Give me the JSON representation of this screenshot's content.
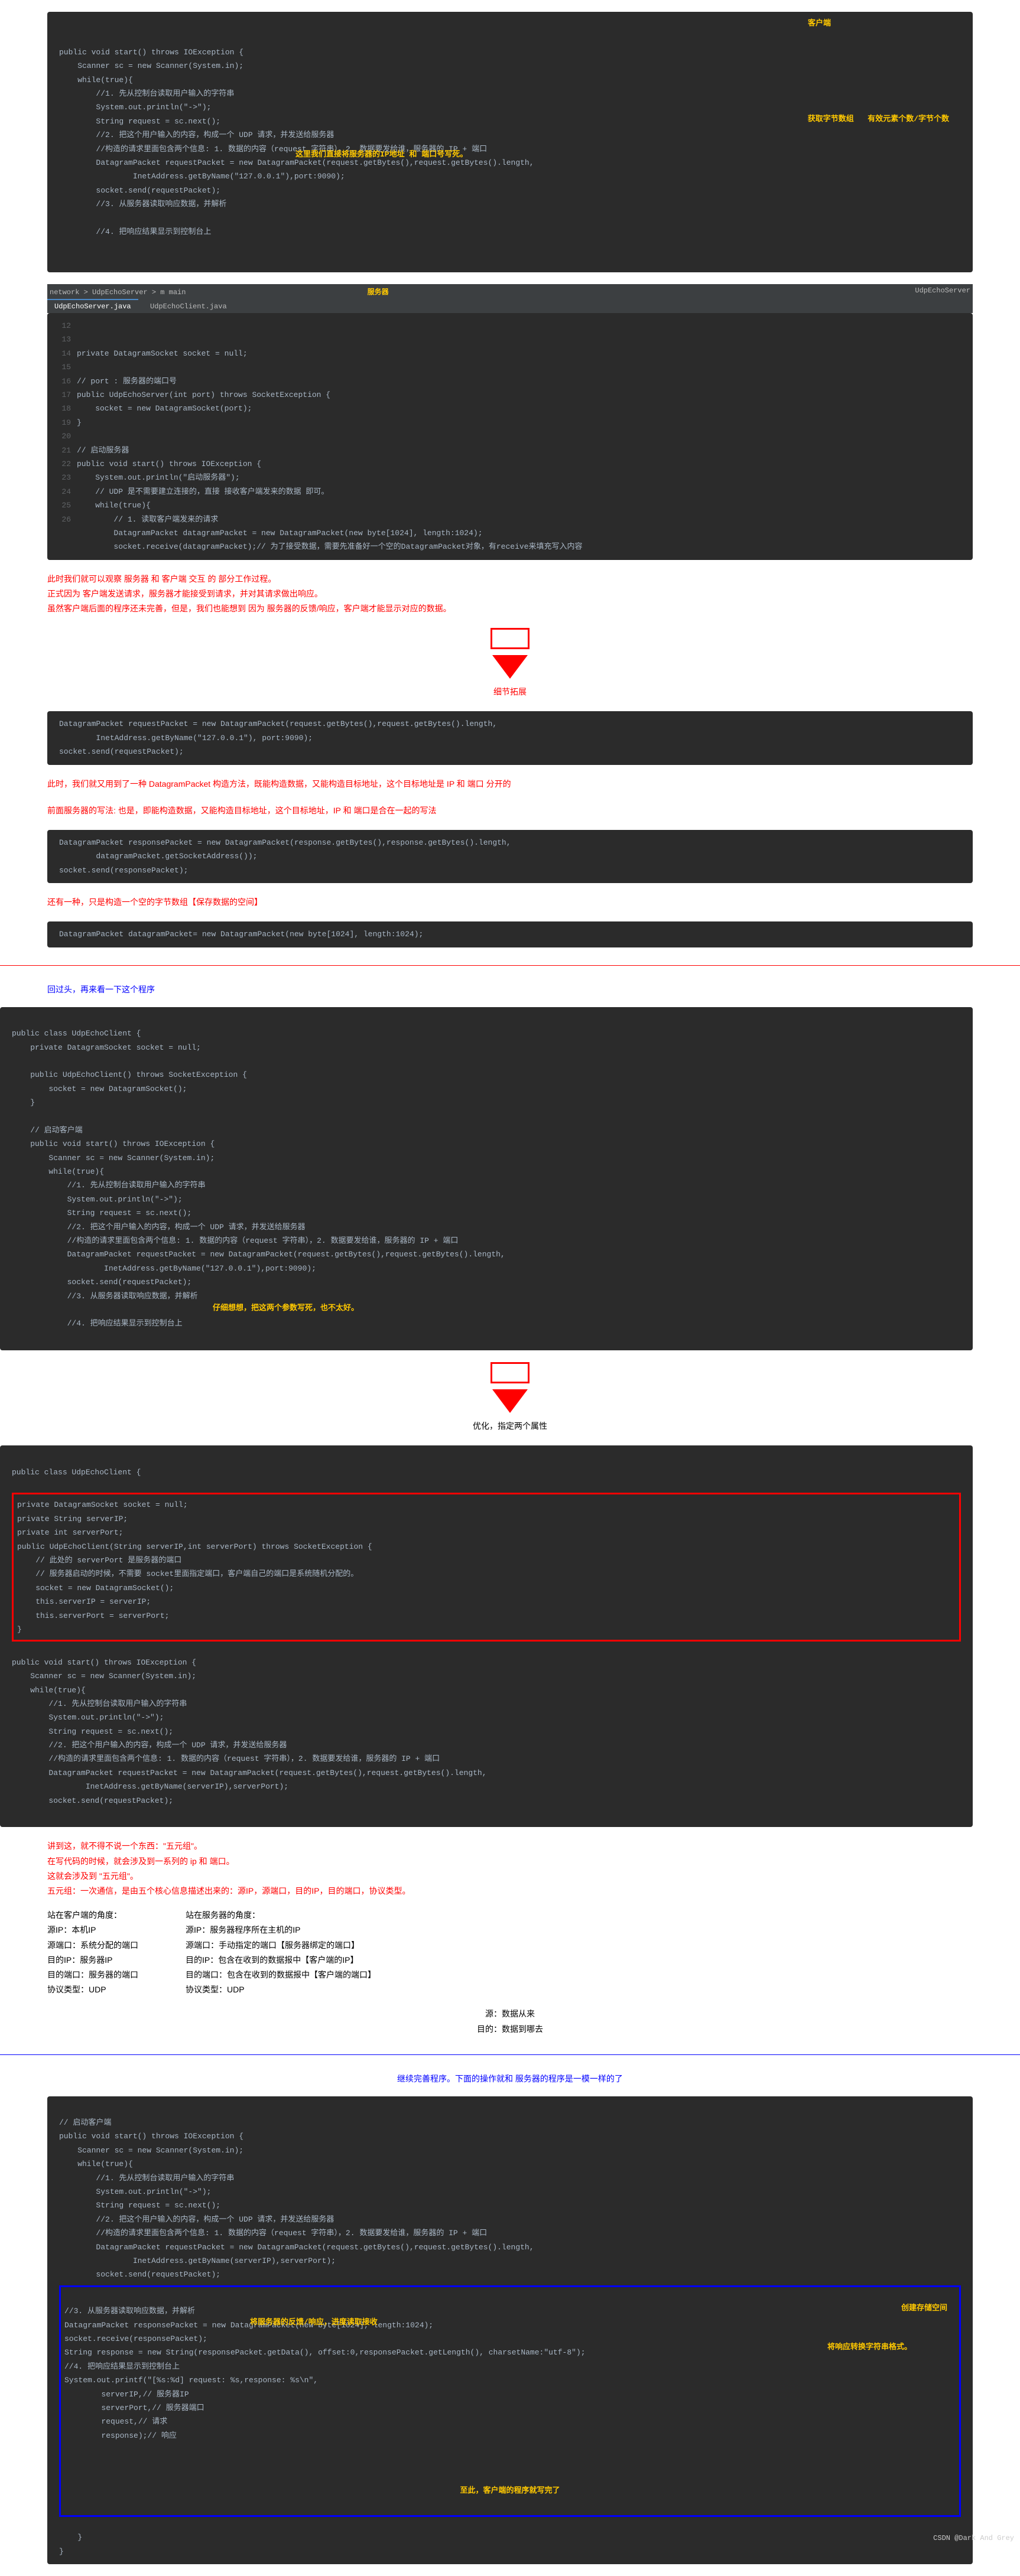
{
  "block1": {
    "title": "客户端",
    "lines": "public void start() throws IOException {\n    Scanner sc = new Scanner(System.in);\n    while(true){\n        //1. 先从控制台读取用户输入的字符串\n        System.out.println(\"->\");\n        String request = sc.next();\n        //2. 把这个用户输入的内容，构成一个 UDP 请求，并发送给服务器\n        //构造的请求里面包含两个信息: 1. 数据的内容（request 字符串），2. 数据要发给谁，服务器的 IP + 端口\n        DatagramPacket requestPacket = new DatagramPacket(request.getBytes(),request.getBytes().length,\n                InetAddress.getByName(\"127.0.0.1\"),port:9090);\n        socket.send(requestPacket);\n        //3. 从服务器读取响应数据，并解析\n\n        //4. 把响应结果显示到控制台上",
    "anno1": "获取字节数组",
    "anno2": "有效元素个数/字节个数",
    "anno3": "这里我们直接将服务器的IP地址 和 端口号写死。"
  },
  "block2": {
    "title": "服务器",
    "tabs": [
      "UdpEchoServer.java",
      "UdpEchoClient.java"
    ],
    "breadcrumb": "network > UdpEchoServer > m main",
    "topRight": "UdpEchoServer",
    "lines": "private DatagramSocket socket = null;\n\n// port : 服务器的端口号\npublic UdpEchoServer(int port) throws SocketException {\n    socket = new DatagramSocket(port);\n}\n\n// 启动服务器\npublic void start() throws IOException {\n    System.out.println(\"启动服务器\");\n    // UDP 是不需要建立连接的，直接 接收客户端发来的数据 即可。\n    while(true){\n        // 1. 读取客户端发来的请求\n        DatagramPacket datagramPacket = new DatagramPacket(new byte[1024], length:1024);\n        socket.receive(datagramPacket);// 为了接受数据，需要先准备好一个空的DatagramPacket对象，有receive来填充写入内容"
  },
  "red1": "此时我们就可以观察 服务器 和 客户端 交互 的 部分工作过程。\n正式因为 客户端发送请求，服务器才能接受到请求，并对其请求做出响应。\n虽然客户端后面的程序还未完善，但是，我们也能想到 因为 服务器的反馈/响应，客户端才能显示对应的数据。",
  "detail": "细节拓展",
  "block3": {
    "lines": "DatagramPacket requestPacket = new DatagramPacket(request.getBytes(),request.getBytes().length,\n        InetAddress.getByName(\"127.0.0.1\"), port:9090);\nsocket.send(requestPacket);"
  },
  "red2": "此时，我们就又用到了一种 DatagramPacket 构造方法，既能构造数据，又能构造目标地址，这个目标地址是 IP 和 端口 分开的",
  "red3": "前面服务器的写法: 也是，即能构造数据，又能构造目标地址，这个目标地址，IP 和 端口是合在一起的写法",
  "block4": {
    "lines": "DatagramPacket responsePacket = new DatagramPacket(response.getBytes(),response.getBytes().length,\n        datagramPacket.getSocketAddress());\nsocket.send(responsePacket);"
  },
  "red4": "还有一种，只是构造一个空的字节数组【保存数据的空间】",
  "block5": {
    "lines": "DatagramPacket datagramPacket= new DatagramPacket(new byte[1024], length:1024);"
  },
  "blue1": "回过头，再来看一下这个程序",
  "block6": {
    "lines": "public class UdpEchoClient {\n    private DatagramSocket socket = null;\n\n    public UdpEchoClient() throws SocketException {\n        socket = new DatagramSocket();\n    }\n\n    // 启动客户端\n    public void start() throws IOException {\n        Scanner sc = new Scanner(System.in);\n        while(true){\n            //1. 先从控制台读取用户输入的字符串\n            System.out.println(\"->\");\n            String request = sc.next();\n            //2. 把这个用户输入的内容，构成一个 UDP 请求，并发送给服务器\n            //构造的请求里面包含两个信息: 1. 数据的内容（request 字符串），2. 数据要发给谁，服务器的 IP + 端口\n            DatagramPacket requestPacket = new DatagramPacket(request.getBytes(),request.getBytes().length,\n                    InetAddress.getByName(\"127.0.0.1\"),port:9090);\n            socket.send(requestPacket);\n            //3. 从服务器读取响应数据，并解析\n\n            //4. 把响应结果显示到控制台上",
    "anno": "仔细想想，把这两个参数写死，也不太好。"
  },
  "opt": "优化，指定两个属性",
  "block7": {
    "header": "public class UdpEchoClient {",
    "redbox": "private DatagramSocket socket = null;\nprivate String serverIP;\nprivate int serverPort;\npublic UdpEchoClient(String serverIP,int serverPort) throws SocketException {\n    // 此处的 serverPort 是服务器的端口\n    // 服务器启动的时候，不需要 socket里面指定端口，客户端自己的端口是系统随机分配的。\n    socket = new DatagramSocket();\n    this.serverIP = serverIP;\n    this.serverPort = serverPort;\n}",
    "rest": "public void start() throws IOException {\n    Scanner sc = new Scanner(System.in);\n    while(true){\n        //1. 先从控制台读取用户输入的字符串\n        System.out.println(\"->\");\n        String request = sc.next();\n        //2. 把这个用户输入的内容，构成一个 UDP 请求，并发送给服务器\n        //构造的请求里面包含两个信息: 1. 数据的内容（request 字符串），2. 数据要发给谁，服务器的 IP + 端口\n        DatagramPacket requestPacket = new DatagramPacket(request.getBytes(),request.getBytes().length,\n                InetAddress.getByName(serverIP),serverPort);\n        socket.send(requestPacket);"
  },
  "wuyuan": {
    "l1": "讲到这，就不得不说一个东西：\"五元组\"。",
    "l2": "在写代码的时候，就会涉及到一系列的 ip 和 端口。",
    "l3": "这就会涉及到 \"五元组\"。",
    "l4": "五元组：一次通信，是由五个核心信息描述出来的：源IP，源端口，目的IP，目的端口，协议类型。"
  },
  "colL": {
    "h": "站在客户端的角度：",
    "r": [
      "源IP：本机IP",
      "源端口：系统分配的端口",
      "目的IP：服务器IP",
      "目的端口：服务器的端口",
      "协议类型：UDP"
    ]
  },
  "colR": {
    "h": "站在服务器的角度：",
    "r": [
      "源IP：服务器程序所在主机的IP",
      "源端口：手动指定的端口【服务器绑定的端口】",
      "目的IP：包含在收到的数据报中【客户端的IP】",
      "目的端口：包含在收到的数据报中【客户端的端口】",
      "协议类型：UDP"
    ]
  },
  "src": "源：数据从来\n目的：数据到哪去",
  "blue2": "继续完善程序。下面的操作就和 服务器的程序是一模一样的了",
  "block8": {
    "lines": "// 启动客户端\npublic void start() throws IOException {\n    Scanner sc = new Scanner(System.in);\n    while(true){\n        //1. 先从控制台读取用户输入的字符串\n        System.out.println(\"->\");\n        String request = sc.next();\n        //2. 把这个用户输入的内容，构成一个 UDP 请求，并发送给服务器\n        //构造的请求里面包含两个信息: 1. 数据的内容（request 字符串），2. 数据要发给谁，服务器的 IP + 端口\n        DatagramPacket requestPacket = new DatagramPacket(request.getBytes(),request.getBytes().length,\n                InetAddress.getByName(serverIP),serverPort);\n        socket.send(requestPacket);",
    "bluebox": "//3. 从服务器读取响应数据，并解析\nDatagramPacket responsePacket = new DatagramPacket(new byte[1024], length:1024);\nsocket.receive(responsePacket);\nString response = new String(responsePacket.getData(), offset:0,responsePacket.getLength(), charsetName:\"utf-8\");\n//4. 把响应结果显示到控制台上\nSystem.out.printf(\"[%s:%d] request: %s,response: %s\\n\",\n        serverIP,// 服务器IP\n        serverPort,// 服务器端口\n        request,// 请求\n        response);// 响应",
    "anno1": "创建存储空间",
    "anno2": "将服务器的反馈/响应，进度读取接收",
    "anno3": "将响应转换字符串格式。",
    "end": "至此，客户端的程序就写完了",
    "close": "    }\n}"
  },
  "watermark": "CSDN @Dark And Grey"
}
